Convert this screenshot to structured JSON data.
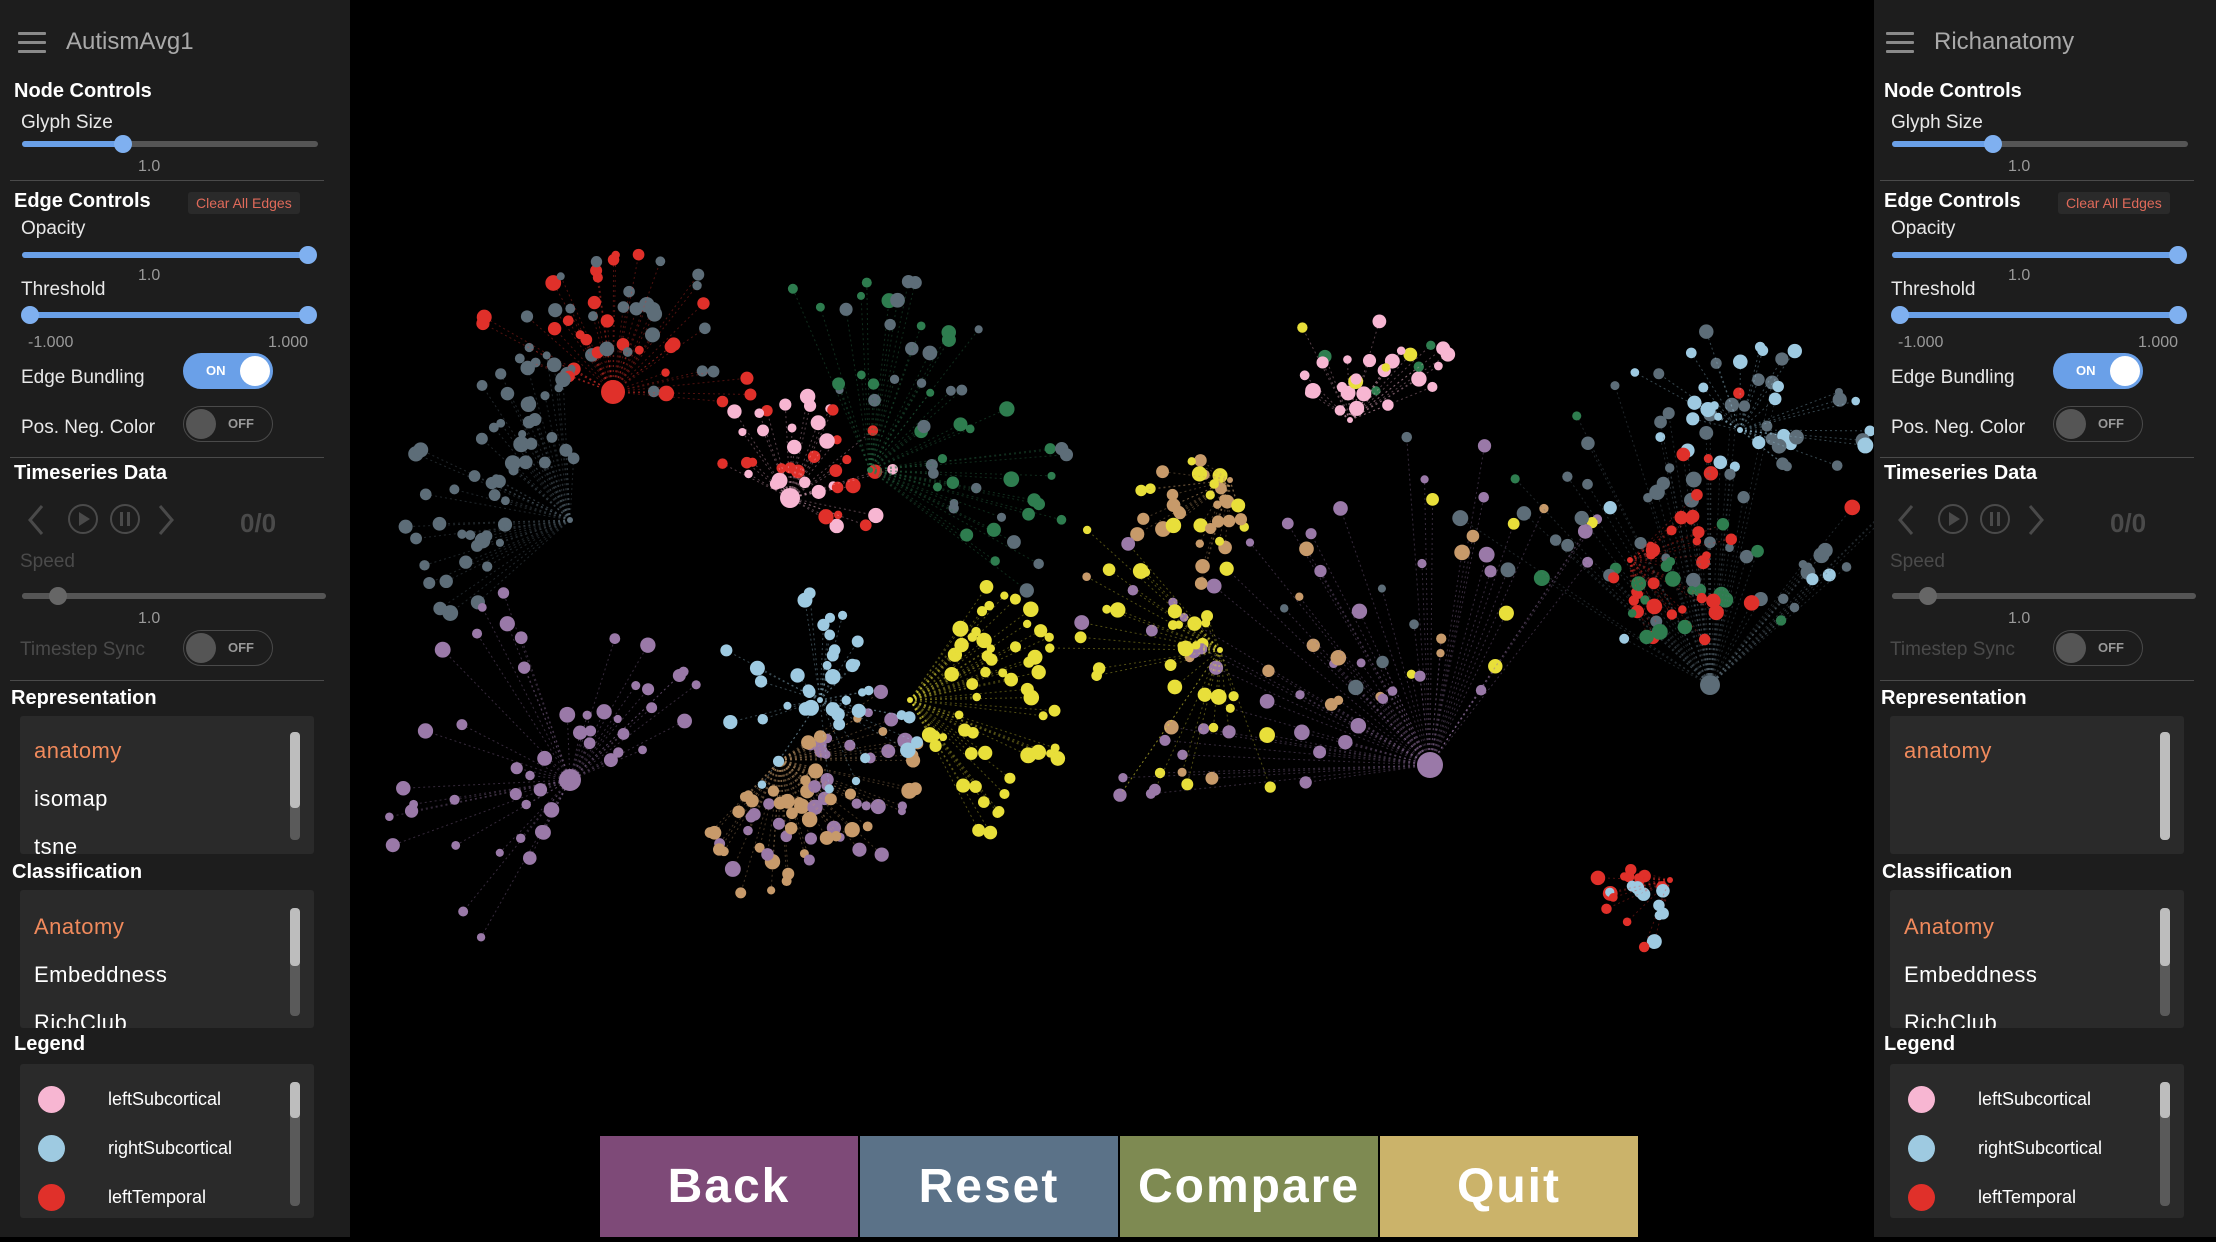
{
  "left_panel": {
    "title": "AutismAvg1",
    "node_controls": {
      "title": "Node Controls",
      "glyph_size_label": "Glyph Size",
      "glyph_size_value": "1.0",
      "glyph_size_level": 0.34
    },
    "edge_controls": {
      "title": "Edge Controls",
      "clear_label": "Clear All Edges",
      "opacity_label": "Opacity",
      "opacity_value": "1.0",
      "opacity_level": 1.0,
      "threshold_label": "Threshold",
      "threshold_min": "-1.000",
      "threshold_max": "1.000",
      "edge_bundling_label": "Edge Bundling",
      "edge_bundling_state": "ON",
      "pos_neg_label": "Pos. Neg. Color",
      "pos_neg_state": "OFF"
    },
    "timeseries": {
      "title": "Timeseries Data",
      "counter": "0/0",
      "speed_label": "Speed",
      "speed_value": "1.0",
      "speed_level": 0.12,
      "sync_label": "Timestep Sync",
      "sync_state": "OFF"
    },
    "representation": {
      "title": "Representation",
      "items": [
        "anatomy",
        "isomap",
        "tsne"
      ],
      "selected": "anatomy"
    },
    "classification": {
      "title": "Classification",
      "items": [
        "Anatomy",
        "Embeddness",
        "RichClub"
      ],
      "selected": "Anatomy"
    },
    "legend": {
      "title": "Legend",
      "items": [
        {
          "label": "leftSubcortical",
          "color": "#f7b6d2"
        },
        {
          "label": "rightSubcortical",
          "color": "#9ecae1"
        },
        {
          "label": "leftTemporal",
          "color": "#e0302a"
        }
      ]
    }
  },
  "right_panel": {
    "title": "Richanatomy",
    "node_controls": {
      "title": "Node Controls",
      "glyph_size_label": "Glyph Size",
      "glyph_size_value": "1.0",
      "glyph_size_level": 0.34
    },
    "edge_controls": {
      "title": "Edge Controls",
      "clear_label": "Clear All Edges",
      "opacity_label": "Opacity",
      "opacity_value": "1.0",
      "opacity_level": 1.0,
      "threshold_label": "Threshold",
      "threshold_min": "-1.000",
      "threshold_max": "1.000",
      "edge_bundling_label": "Edge Bundling",
      "edge_bundling_state": "ON",
      "pos_neg_label": "Pos. Neg. Color",
      "pos_neg_state": "OFF"
    },
    "timeseries": {
      "title": "Timeseries Data",
      "counter": "0/0",
      "speed_label": "Speed",
      "speed_value": "1.0",
      "speed_level": 0.12,
      "sync_label": "Timestep Sync",
      "sync_state": "OFF"
    },
    "representation": {
      "title": "Representation",
      "items": [
        "anatomy"
      ],
      "selected": "anatomy"
    },
    "classification": {
      "title": "Classification",
      "items": [
        "Anatomy",
        "Embeddness",
        "RichClub"
      ],
      "selected": "Anatomy"
    },
    "legend": {
      "title": "Legend",
      "items": [
        {
          "label": "leftSubcortical",
          "color": "#f7b6d2"
        },
        {
          "label": "rightSubcortical",
          "color": "#9ecae1"
        },
        {
          "label": "leftTemporal",
          "color": "#e0302a"
        }
      ]
    }
  },
  "bottom_bar": {
    "buttons": [
      {
        "label": "Back",
        "color": "#7e4a78"
      },
      {
        "label": "Reset",
        "color": "#5b7288"
      },
      {
        "label": "Compare",
        "color": "#7e8a52"
      },
      {
        "label": "Quit",
        "color": "#cbb36a"
      }
    ]
  },
  "node_palette": {
    "leftSubcortical": "#f7b6d2",
    "rightSubcortical": "#9ecae1",
    "leftTemporal": "#e0302a",
    "parietal": "#5d6d78",
    "frontal": "#2e7d4f",
    "occipital": "#9a79a8",
    "temporal": "#c79a6a",
    "yellow": "#e8df3a"
  }
}
